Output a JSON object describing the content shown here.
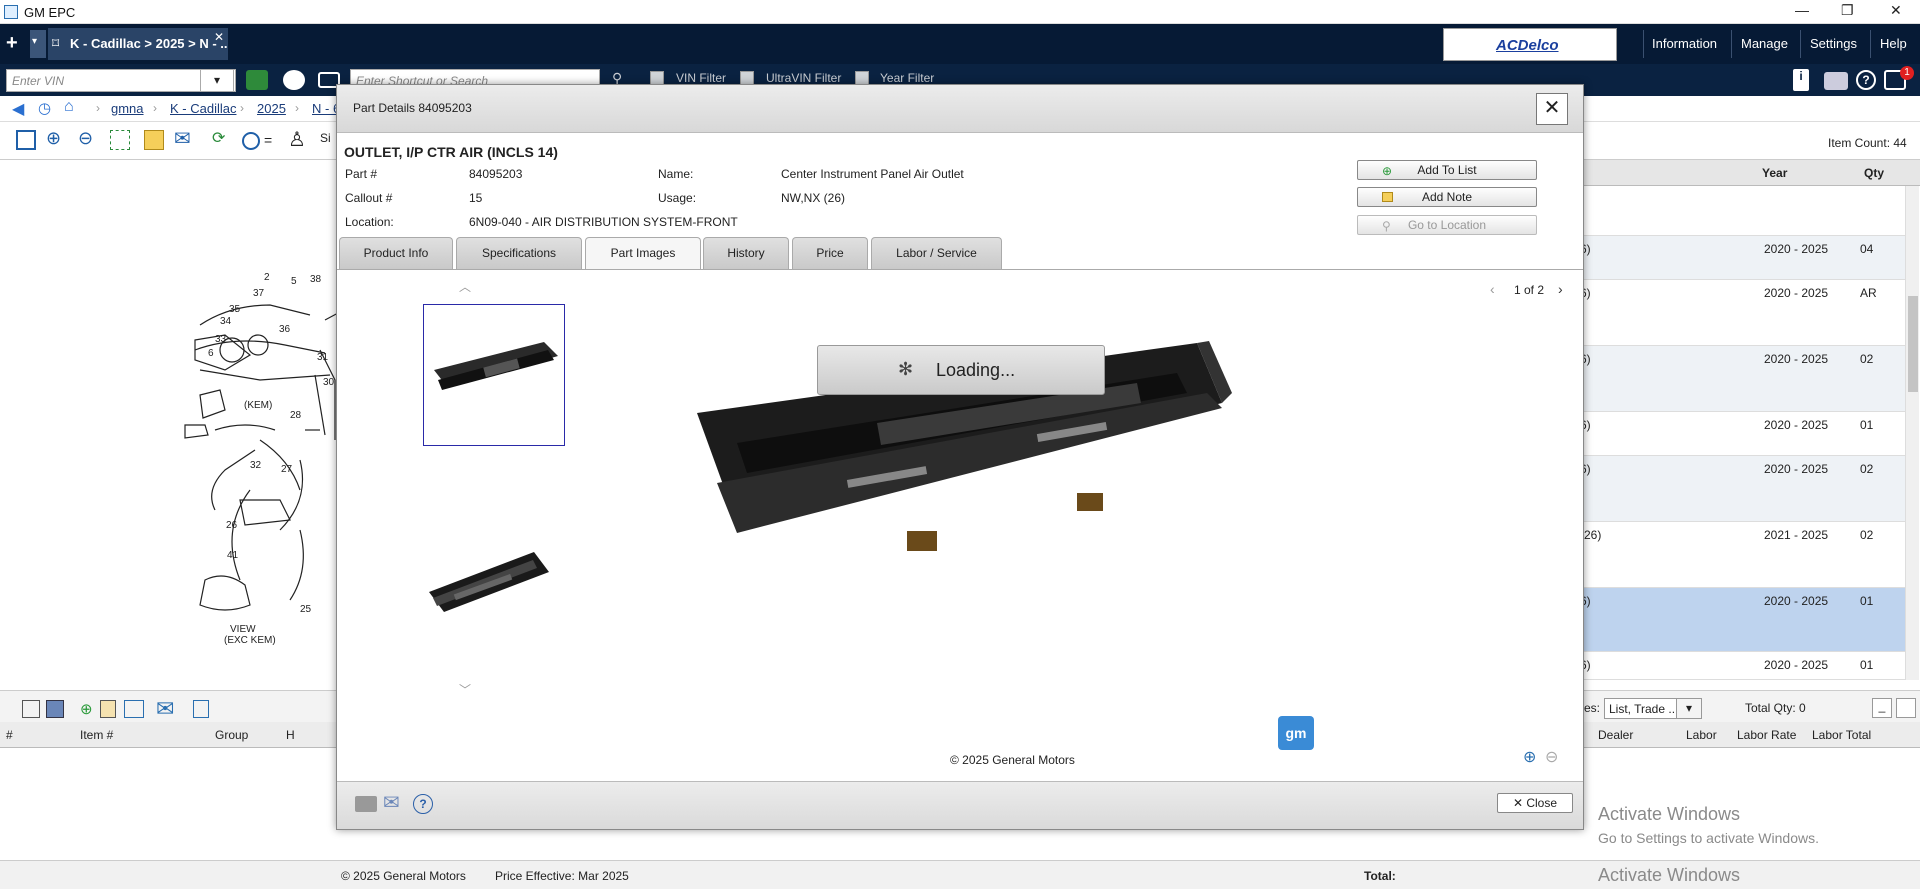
{
  "window": {
    "title": "GM EPC"
  },
  "nav": {
    "tab_label": "K - Cadillac > 2025 > N - ...",
    "brand": "ACDelco",
    "menu": [
      "Information",
      "Manage",
      "Settings",
      "Help"
    ],
    "notification_count": "1"
  },
  "toolbar": {
    "vin_placeholder": "Enter VIN",
    "shortcut_placeholder": "Enter Shortcut or Search",
    "vin_filter": "VIN Filter",
    "ultravin_filter": "UltraVIN Filter",
    "year_filter": "Year Filter"
  },
  "breadcrumb": [
    "gmna",
    "K - Cadillac",
    "2025",
    "N - 6"
  ],
  "diagram": {
    "labels": [
      "2",
      "5",
      "37",
      "38",
      "35",
      "36",
      "34",
      "33",
      "31",
      "6",
      "(KEM)",
      "28",
      "30",
      "32",
      "27",
      "26",
      "41",
      "25",
      "VIEW",
      "(EXC KEM)"
    ]
  },
  "right_grid": {
    "item_count": "Item Count: 44",
    "columns": [
      "Year",
      "Qty"
    ],
    "rows": [
      {
        "desc": "6)",
        "year": "2020 - 2025",
        "qty": "04"
      },
      {
        "desc": "6)",
        "year": "2020 - 2025",
        "qty": "AR"
      },
      {
        "desc": "6)",
        "year": "2020 - 2025",
        "qty": "02"
      },
      {
        "desc": "6)",
        "year": "2020 - 2025",
        "qty": "01"
      },
      {
        "desc": "6)",
        "year": "2020 - 2025",
        "qty": "02"
      },
      {
        "desc": " (26)",
        "year": "2021 - 2025",
        "qty": "02"
      },
      {
        "desc": "6)",
        "year": "2020 - 2025",
        "qty": "01"
      },
      {
        "desc": "6)",
        "year": "2020 - 2025",
        "qty": "01"
      }
    ]
  },
  "lower": {
    "prices_label": "es:",
    "prices_value": "List, Trade ...",
    "total_qty": "Total Qty: 0",
    "columns_left": [
      "#",
      "Item #",
      "Group",
      "H"
    ],
    "columns_right": [
      "Dealer",
      "Labor",
      "Labor Rate",
      "Labor Total"
    ]
  },
  "status": {
    "copyright": "© 2025 General Motors",
    "price_effective": "Price Effective: Mar 2025",
    "total": "Total:",
    "activate_title": "Activate Windows",
    "activate_sub": "Go to Settings to activate Windows.",
    "activate_title2": "Activate Windows"
  },
  "modal": {
    "title": "Part Details 84095203",
    "heading": "OUTLET, I/P CTR AIR (INCLS 14)",
    "fields": {
      "part_label": "Part #",
      "part_value": "84095203",
      "callout_label": "Callout #",
      "callout_value": "15",
      "location_label": "Location:",
      "location_value": "6N09-040 - AIR DISTRIBUTION SYSTEM-FRONT",
      "name_label": "Name:",
      "name_value": "Center Instrument Panel Air Outlet",
      "usage_label": "Usage:",
      "usage_value": "NW,NX (26)"
    },
    "buttons": {
      "add_to_list": "Add To List",
      "add_note": "Add Note",
      "go_to_location": "Go to Location"
    },
    "tabs": [
      "Product Info",
      "Specifications",
      "Part Images",
      "History",
      "Price",
      "Labor / Service"
    ],
    "active_tab": "Part Images",
    "pager": "1 of 2",
    "loading": "Loading...",
    "copyright": "© 2025 General Motors",
    "gm_logo": "gm",
    "close": "Close"
  }
}
